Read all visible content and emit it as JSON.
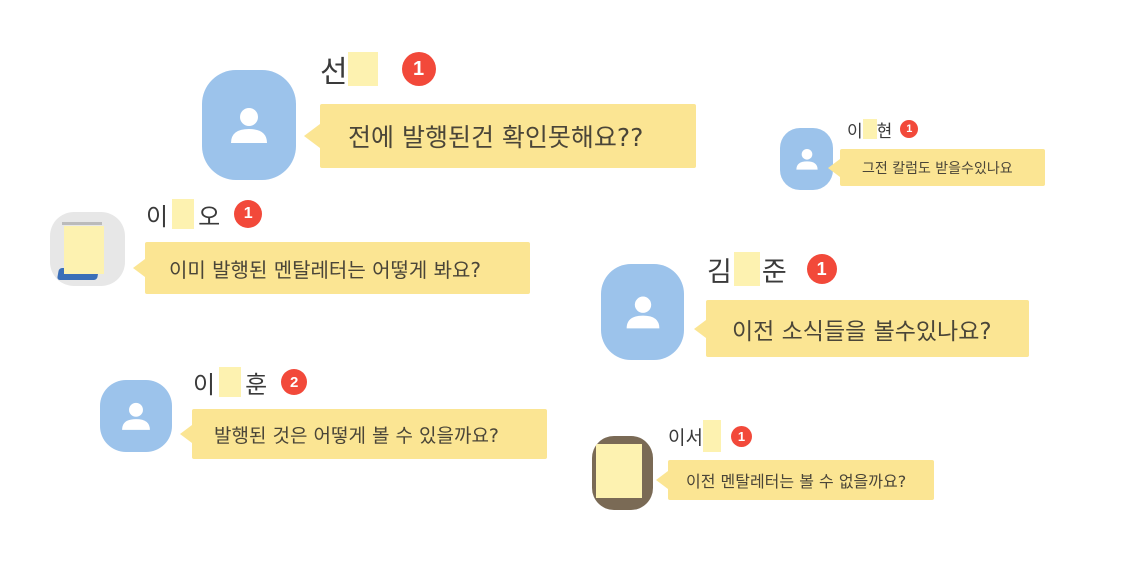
{
  "messages": [
    {
      "name_first": "선",
      "name_last": "",
      "badge": "1",
      "text": "전에 발행된건 확인못해요??",
      "avatar": "person-icon"
    },
    {
      "name_first": "이",
      "name_last": "현",
      "badge": "1",
      "text": "그전 칼럼도 받을수있나요",
      "avatar": "person-icon"
    },
    {
      "name_first": "이",
      "name_last": "오",
      "badge": "1",
      "text": "이미 발행된 멘탈레터는 어떻게 봐요?",
      "avatar": "photo"
    },
    {
      "name_first": "김",
      "name_last": "준",
      "badge": "1",
      "text": "이전 소식들을 볼수있나요?",
      "avatar": "person-icon"
    },
    {
      "name_first": "이",
      "name_last": "훈",
      "badge": "2",
      "text": "발행된 것은 어떻게 볼 수 있을까요?",
      "avatar": "person-icon"
    },
    {
      "name_first": "이서",
      "name_last": "",
      "badge": "1",
      "text": "이전 멘탈레터는 볼 수 없을까요?",
      "avatar": "photo"
    }
  ]
}
